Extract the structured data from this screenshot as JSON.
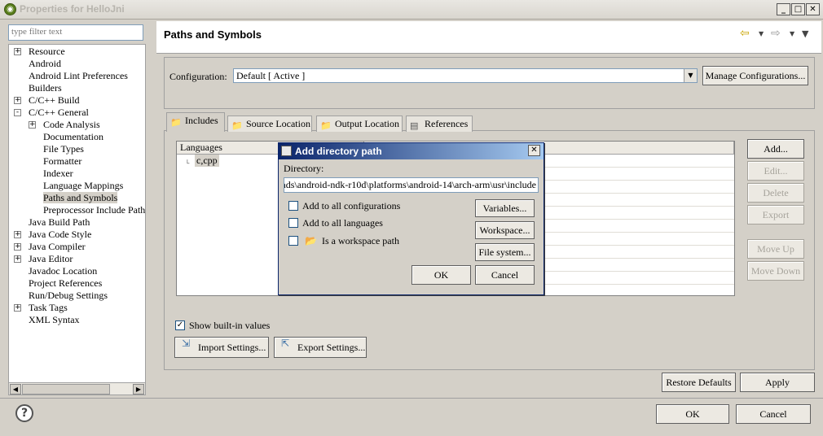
{
  "window": {
    "title": "Properties for HelloJni"
  },
  "filter": {
    "placeholder": "type filter text"
  },
  "tree": {
    "items": [
      {
        "label": "Resource",
        "level": 0,
        "expander": "+"
      },
      {
        "label": "Android",
        "level": 0
      },
      {
        "label": "Android Lint Preferences",
        "level": 0
      },
      {
        "label": "Builders",
        "level": 0
      },
      {
        "label": "C/C++ Build",
        "level": 0,
        "expander": "+"
      },
      {
        "label": "C/C++ General",
        "level": 0,
        "expander": "-"
      },
      {
        "label": "Code Analysis",
        "level": 1,
        "expander": "+"
      },
      {
        "label": "Documentation",
        "level": 1
      },
      {
        "label": "File Types",
        "level": 1
      },
      {
        "label": "Formatter",
        "level": 1
      },
      {
        "label": "Indexer",
        "level": 1
      },
      {
        "label": "Language Mappings",
        "level": 1
      },
      {
        "label": "Paths and Symbols",
        "level": 1,
        "selected": true
      },
      {
        "label": "Preprocessor Include Paths",
        "level": 1
      },
      {
        "label": "Java Build Path",
        "level": 0
      },
      {
        "label": "Java Code Style",
        "level": 0,
        "expander": "+"
      },
      {
        "label": "Java Compiler",
        "level": 0,
        "expander": "+"
      },
      {
        "label": "Java Editor",
        "level": 0,
        "expander": "+"
      },
      {
        "label": "Javadoc Location",
        "level": 0
      },
      {
        "label": "Project References",
        "level": 0
      },
      {
        "label": "Run/Debug Settings",
        "level": 0
      },
      {
        "label": "Task Tags",
        "level": 0,
        "expander": "+"
      },
      {
        "label": "XML Syntax",
        "level": 0
      }
    ]
  },
  "page": {
    "title": "Paths and Symbols",
    "configuration_label": "Configuration:",
    "configuration_value": "Default  [ Active ]",
    "manage_button": "Manage Configurations...",
    "tabs": [
      {
        "label": "Includes",
        "active": true
      },
      {
        "label": "Source Location"
      },
      {
        "label": "Output Location"
      },
      {
        "label": "References"
      }
    ],
    "languages_header": "Languages",
    "language_item": "c,cpp",
    "side_buttons": [
      {
        "label": "Add...",
        "enabled": true
      },
      {
        "label": "Edit...",
        "enabled": false
      },
      {
        "label": "Delete",
        "enabled": false
      },
      {
        "label": "Export",
        "enabled": false
      },
      {
        "label": "Move Up",
        "enabled": false
      },
      {
        "label": "Move Down",
        "enabled": false
      }
    ],
    "show_builtin_label": "Show built-in values",
    "show_builtin_checked": true,
    "import_button": "Import Settings...",
    "export_button": "Export Settings...",
    "restore_button": "Restore Defaults",
    "apply_button": "Apply"
  },
  "dialog": {
    "title": "Add directory path",
    "directory_label": "Directory:",
    "directory_value": "‎ads\\android-ndk-r10d\\platforms\\android-14\\arch-arm\\usr\\include",
    "add_all_configs": "Add to all configurations",
    "add_all_languages": "Add to all languages",
    "workspace_path": "Is a workspace path",
    "variables_button": "Variables...",
    "workspace_button": "Workspace...",
    "filesystem_button": "File system...",
    "ok_button": "OK",
    "cancel_button": "Cancel"
  },
  "footer": {
    "ok_button": "OK",
    "cancel_button": "Cancel",
    "help_icon": "?"
  },
  "colors": {
    "dialog_title_start": "#0a246a",
    "dialog_title_end": "#a6caf0",
    "face": "#d4d0c8"
  },
  "icons": [
    "app-icon",
    "back-arrow-icon",
    "forward-arrow-icon",
    "menu-chevron-icon",
    "folder-icon",
    "help-icon"
  ]
}
